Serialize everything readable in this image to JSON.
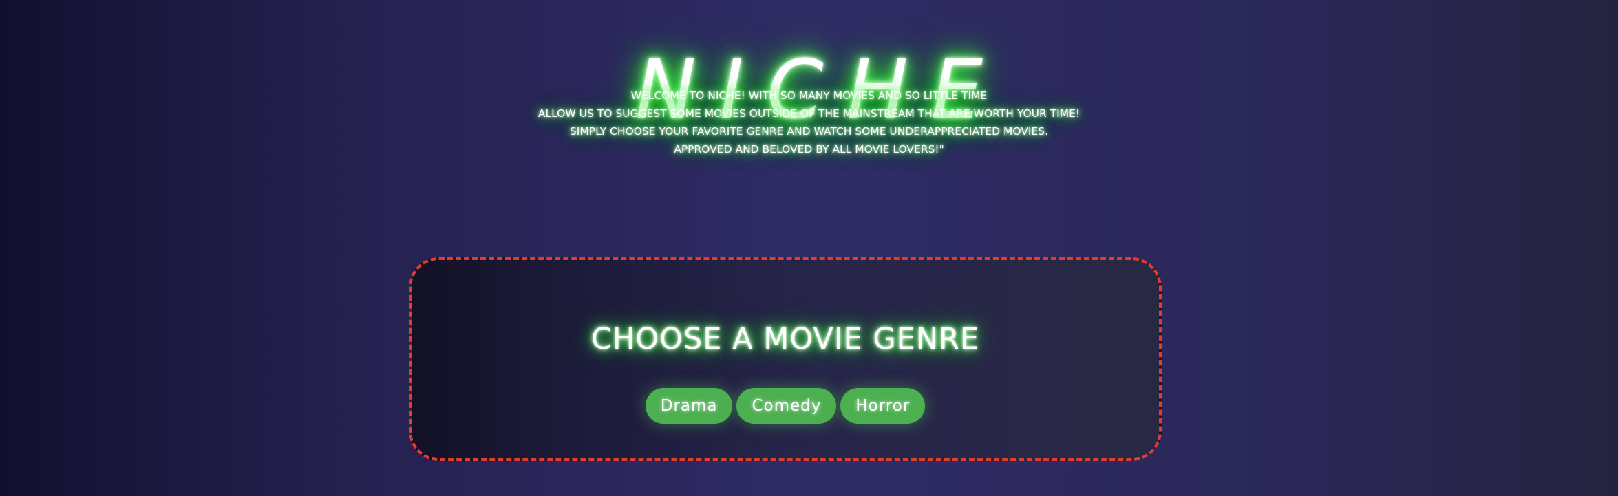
{
  "header": {
    "logo": "NICHE",
    "intro_lines": [
      "WELCOME TO NICHE! WITH SO MANY MOVIES AND SO LITTLE TIME",
      "ALLOW US TO SUGGEST SOME MOVIES OUTSIDE OF THE MAINSTREAM THAT ARE WORTH YOUR TIME!",
      "SIMPLY CHOOSE YOUR FAVORITE GENRE AND WATCH SOME UNDERAPPRECIATED MOVIES.",
      "APPROVED AND BELOVED BY ALL MOVIE LOVERS!\""
    ]
  },
  "genre_picker": {
    "title": "CHOOSE A MOVIE GENRE",
    "buttons": [
      "Drama",
      "Comedy",
      "Horror"
    ]
  },
  "colors": {
    "neon_glow": "#38ff38",
    "button_green": "#4caf50",
    "dashed_border": "#e53b2f",
    "background": "#2c2960"
  }
}
